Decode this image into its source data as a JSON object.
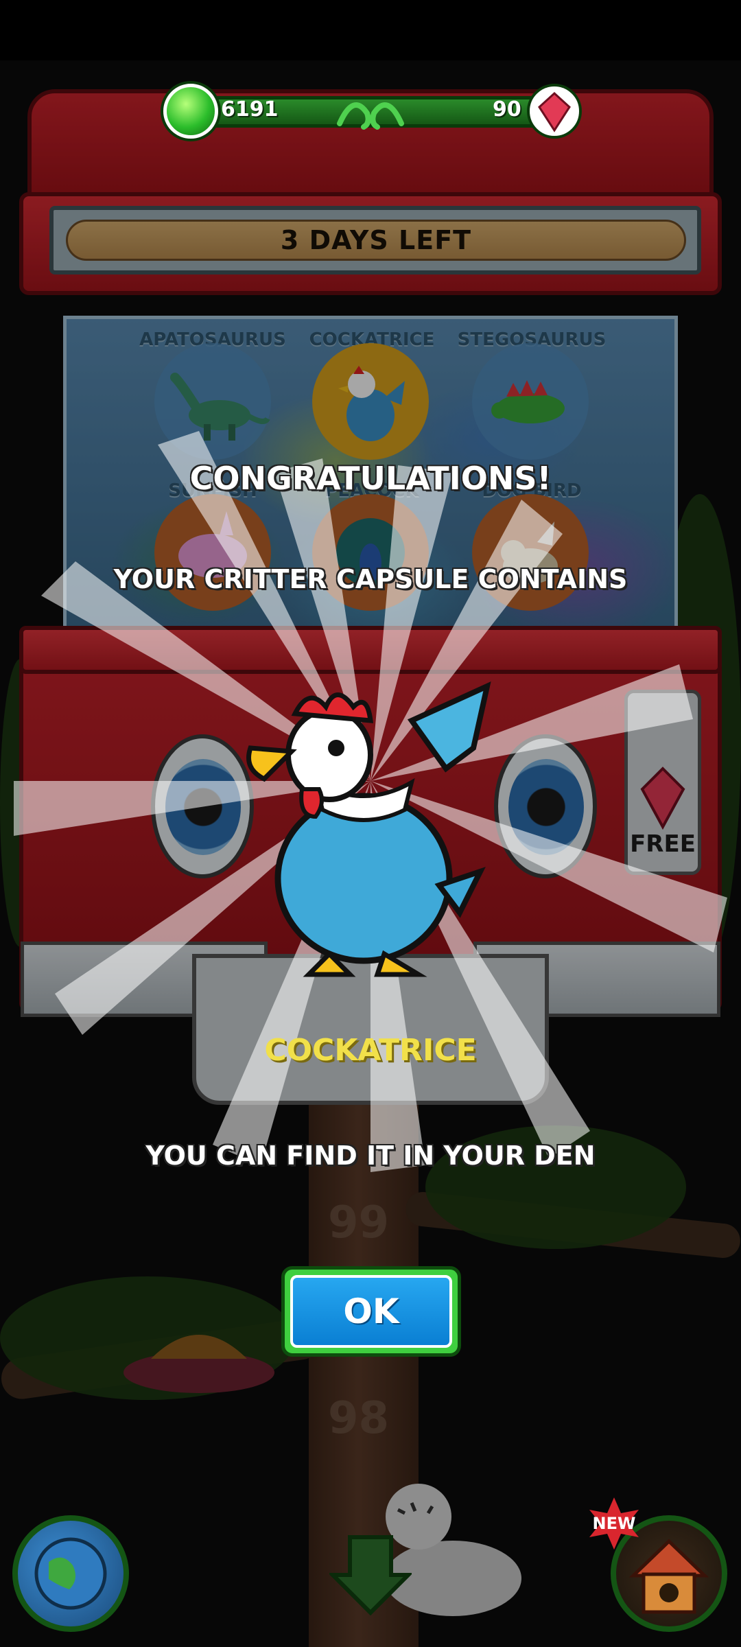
{
  "currency": {
    "gems_green": "6191",
    "gems_red": "90"
  },
  "banner": {
    "time_left": "3 DAYS LEFT"
  },
  "machine": {
    "slots": [
      {
        "label": "APATOSAURUS",
        "icon": "apatosaurus-icon"
      },
      {
        "label": "COCKATRICE",
        "icon": "cockatrice-icon"
      },
      {
        "label": "STEGOSAURUS",
        "icon": "stegosaurus-icon"
      },
      {
        "label": "SUNFISH",
        "icon": "sunfish-icon"
      },
      {
        "label": "PEACOCK",
        "icon": "peacock-icon"
      },
      {
        "label": "DOG BIRD",
        "icon": "dog-bird-icon"
      }
    ],
    "free_label": "FREE"
  },
  "reward": {
    "title": "CONGRATULATIONS!",
    "subtitle": "YOUR CRITTER CAPSULE CONTAINS",
    "critter_name": "COCKATRICE",
    "info": "YOU CAN FIND IT IN YOUR DEN",
    "ok_label": "OK"
  },
  "background": {
    "floor_numbers": [
      "99",
      "98"
    ],
    "new_badge": "NEW"
  },
  "colors": {
    "machine_red": "#c7232b",
    "currency_green": "#2a8a2a",
    "ok_blue": "#0a7fd3",
    "critter_name_yellow": "#f1e04a"
  }
}
